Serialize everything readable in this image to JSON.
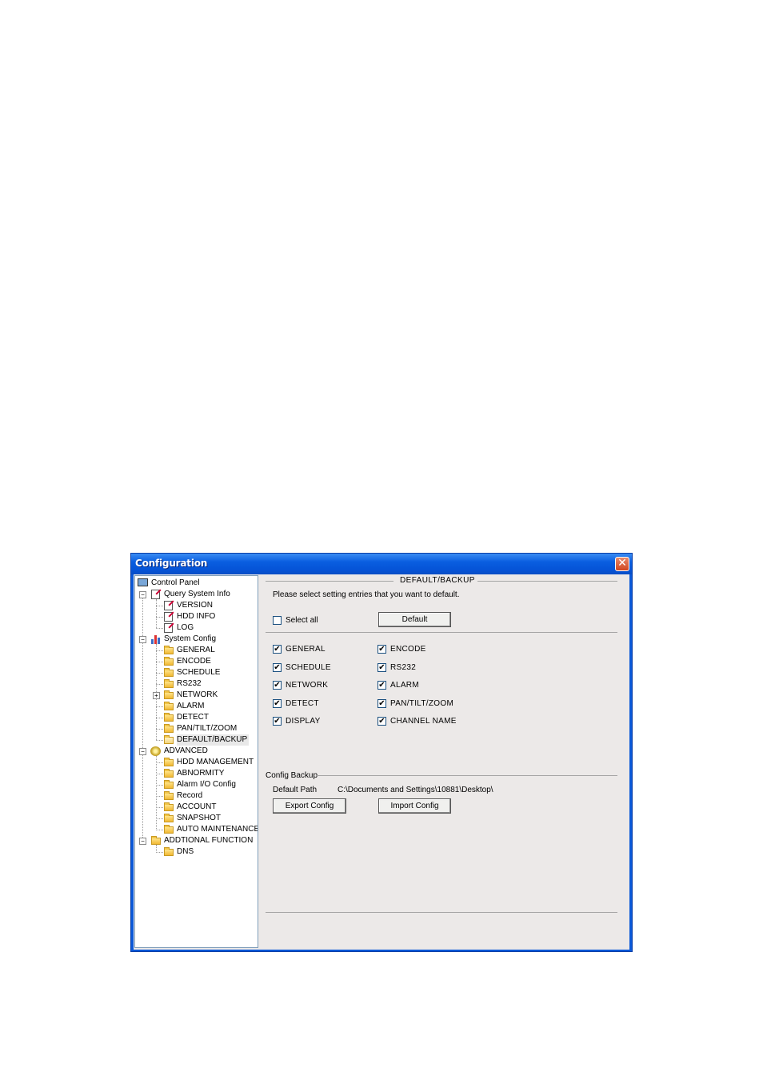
{
  "window": {
    "title": "Configuration",
    "close_glyph": "✕"
  },
  "tree": {
    "root": "Control Panel",
    "query_system_info": {
      "label": "Query System Info",
      "children": [
        "VERSION",
        "HDD INFO",
        "LOG"
      ]
    },
    "system_config": {
      "label": "System Config",
      "children": [
        "GENERAL",
        "ENCODE",
        "SCHEDULE",
        "RS232",
        "NETWORK",
        "ALARM",
        "DETECT",
        "PAN/TILT/ZOOM",
        "DEFAULT/BACKUP"
      ]
    },
    "advanced": {
      "label": "ADVANCED",
      "children": [
        "HDD MANAGEMENT",
        "ABNORMITY",
        "Alarm I/O Config",
        "Record",
        "ACCOUNT",
        "SNAPSHOT",
        "AUTO MAINTENANCE"
      ]
    },
    "additional": {
      "label": "ADDTIONAL FUNCTION",
      "children": [
        "DNS"
      ]
    },
    "selected": "DEFAULT/BACKUP",
    "minus_glyph": "−",
    "plus_glyph": "+"
  },
  "panel": {
    "section_title": "DEFAULT/BACKUP",
    "instruction": "Please select setting entries that you want to default.",
    "select_all_label": "Select all",
    "select_all_checked": false,
    "default_button": "Default",
    "check_glyph": "✔",
    "entries_left": [
      {
        "label": "GENERAL",
        "checked": true
      },
      {
        "label": "SCHEDULE",
        "checked": true
      },
      {
        "label": "NETWORK",
        "checked": true
      },
      {
        "label": "DETECT",
        "checked": true
      },
      {
        "label": "DISPLAY",
        "checked": true
      }
    ],
    "entries_right": [
      {
        "label": "ENCODE",
        "checked": true
      },
      {
        "label": "RS232",
        "checked": true
      },
      {
        "label": "ALARM",
        "checked": true
      },
      {
        "label": "PAN/TILT/ZOOM",
        "checked": true
      },
      {
        "label": "CHANNEL NAME",
        "checked": true
      }
    ],
    "backup": {
      "title": "Config Backup",
      "path_label": "Default Path",
      "path_value": "C:\\Documents and Settings\\10881\\Desktop\\",
      "export_button": "Export Config",
      "import_button": "Import Config"
    }
  }
}
